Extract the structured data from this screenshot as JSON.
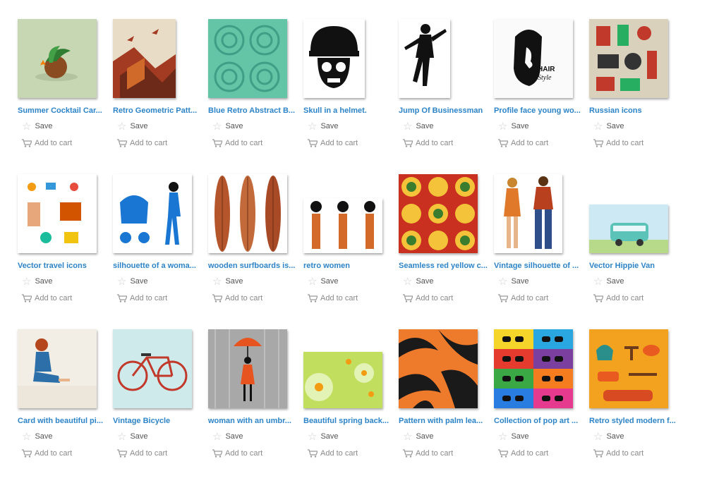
{
  "save_label": "Save",
  "cart_label": "Add to cart",
  "items": [
    {
      "title": "Summer Cocktail Car...",
      "bg": "#c9d9b8"
    },
    {
      "title": "Retro Geometric Patt...",
      "bg": "#e7d9c7"
    },
    {
      "title": "Blue Retro Abstract B...",
      "bg": "#5cc2a4"
    },
    {
      "title": "Skull in a helmet.",
      "bg": "#ffffff"
    },
    {
      "title": "Jump Of Businessman",
      "bg": "#ffffff"
    },
    {
      "title": "Profile face young wo...",
      "bg": "#ffffff"
    },
    {
      "title": "Russian icons",
      "bg": "#d7d0bd"
    },
    {
      "title": "Vector travel icons",
      "bg": "#ffffff"
    },
    {
      "title": "silhouette of a woma...",
      "bg": "#ffffff"
    },
    {
      "title": "wooden surfboards is...",
      "bg": "#ffffff"
    },
    {
      "title": "retro women",
      "bg": "#ffffff"
    },
    {
      "title": "Seamless red yellow c...",
      "bg": "#d93a23"
    },
    {
      "title": "Vintage silhouette of ...",
      "bg": "#ffffff"
    },
    {
      "title": "Vector Hippie Van",
      "bg": "#c6e7f2"
    },
    {
      "title": "Card with beautiful pi...",
      "bg": "#f1ece4"
    },
    {
      "title": "Vintage Bicycle",
      "bg": "#c9e8e8"
    },
    {
      "title": "woman with an umbr...",
      "bg": "#a4a4a4"
    },
    {
      "title": "Beautiful spring back...",
      "bg": "#bfdc5a"
    },
    {
      "title": "Pattern with palm lea...",
      "bg": "#f07a2e"
    },
    {
      "title": "Collection of pop art ...",
      "bg": "#f5d52a"
    },
    {
      "title": "Retro styled modern f...",
      "bg": "#f2a31c"
    }
  ]
}
